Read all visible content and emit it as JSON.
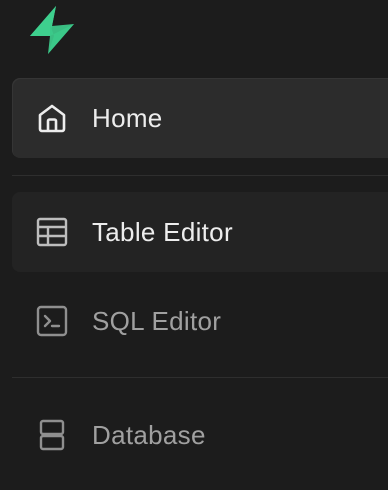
{
  "brand": {
    "logo_icon": "supabase-bolt-icon",
    "logo_color_light": "#3ecf8e",
    "logo_color_dark": "#249361"
  },
  "sidebar": {
    "items": [
      {
        "label": "Home",
        "icon": "home-icon",
        "state": "active"
      },
      {
        "label": "Table Editor",
        "icon": "table-icon",
        "state": "hovered"
      },
      {
        "label": "SQL Editor",
        "icon": "terminal-icon",
        "state": "default"
      },
      {
        "label": "Database",
        "icon": "database-icon",
        "state": "default"
      }
    ]
  },
  "colors": {
    "background": "#1c1c1c",
    "active_item": "#2c2c2c",
    "hover_item": "#232323",
    "text_bright": "#ededed",
    "text_dim": "#a0a0a0"
  }
}
